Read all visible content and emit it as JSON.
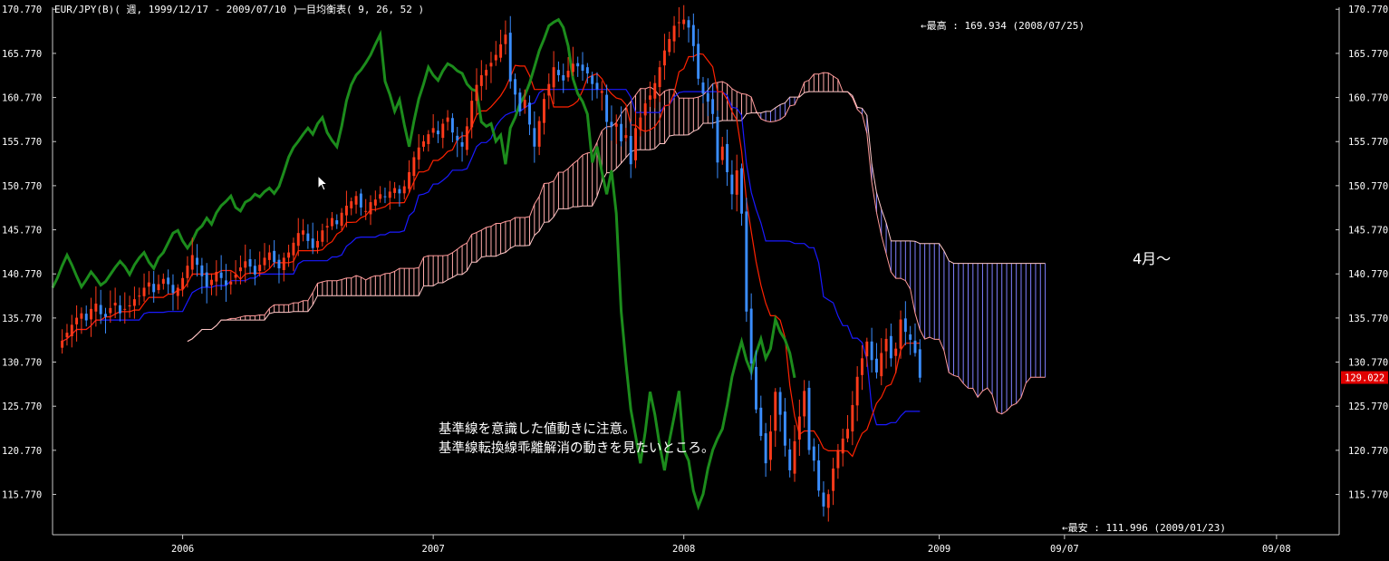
{
  "header": {
    "symbol_title": "EUR/JPY(B)( 週, 1999/12/17 - 2009/07/10 )",
    "indicator": "一目均衡表( 9, 26, 52 )"
  },
  "annotations": {
    "high": "←最高 : 169.934 (2008/07/25)",
    "low": "←最安 : 111.996 (2009/01/23)",
    "april": "4月～",
    "note_line1": "基準線を意識した値動きに注意。",
    "note_line2": "基準線転換線乖離解消の動きを見たいところ。",
    "last_price": "129.022"
  },
  "colors": {
    "background": "#000000",
    "axis": "#c8c8c8",
    "candle_up": "#ff3a1a",
    "candle_down": "#3a8dff",
    "tenkan": "#ff2200",
    "kijun": "#1a1aff",
    "chikou": "#1c8c1c",
    "cloud_up": "#ffaaaa",
    "cloud_down": "#8080ff",
    "price_badge": "#e00000"
  },
  "chart_data": {
    "type": "candlestick-ichimoku",
    "ylim": [
      111.2,
      171.0
    ],
    "y_ticks": [
      "170.770",
      "165.770",
      "160.770",
      "155.770",
      "150.770",
      "145.770",
      "140.770",
      "135.770",
      "130.770",
      "125.770",
      "120.770",
      "115.770"
    ],
    "x_ticks": [
      {
        "label": "2006",
        "week": 0
      },
      {
        "label": "2007",
        "week": 52
      },
      {
        "label": "2008",
        "week": 104
      },
      {
        "label": "2009",
        "week": 157
      },
      {
        "label": "09/07",
        "week": 183
      },
      {
        "label": "09/08",
        "week": 227
      }
    ],
    "x_first_visible_week": -27,
    "x_last_visible_week": 240,
    "weeks_plotted": "2005-07 .. 2009-07-10",
    "close": [
      133.2,
      134.1,
      135.0,
      135.8,
      136.3,
      135.5,
      136.8,
      137.4,
      136.2,
      135.9,
      136.9,
      137.5,
      136.3,
      136.8,
      137.2,
      137.9,
      138.3,
      139.2,
      139.8,
      138.7,
      139.6,
      140.2,
      139.6,
      138.6,
      139.2,
      140.3,
      141.7,
      142.9,
      141.8,
      140.5,
      139.3,
      140.1,
      141.0,
      140.3,
      139.5,
      139.9,
      140.7,
      141.5,
      142.2,
      141.6,
      140.7,
      141.8,
      142.6,
      143.2,
      142.1,
      141.4,
      142.6,
      143.2,
      144.3,
      145.4,
      145.7,
      144.5,
      143.7,
      144.5,
      145.7,
      146.2,
      147.1,
      146.4,
      147.7,
      148.5,
      149.0,
      149.6,
      148.3,
      147.9,
      148.9,
      149.2,
      149.8,
      149.5,
      150.1,
      150.5,
      149.9,
      150.7,
      152.3,
      154.0,
      155.1,
      155.8,
      156.6,
      157.3,
      156.6,
      157.8,
      158.5,
      156.8,
      155.9,
      155.2,
      157.5,
      160.4,
      162.2,
      163.3,
      163.9,
      164.7,
      165.6,
      166.8,
      167.9,
      162.6,
      161.1,
      159.2,
      160.5,
      157.7,
      155.2,
      158.1,
      160.6,
      162.3,
      164.2,
      163.3,
      162.7,
      163.8,
      164.6,
      164.3,
      163.8,
      163.5,
      162.3,
      161.7,
      161.5,
      158.0,
      157.5,
      157.8,
      155.8,
      156.5,
      153.2,
      157.3,
      158.5,
      160.1,
      161.0,
      162.4,
      164.2,
      166.1,
      167.4,
      168.9,
      169.3,
      169.6,
      168.7,
      166.6,
      162.9,
      161.2,
      160.3,
      158.9,
      153.4,
      155.2,
      152.3,
      149.8,
      152.5,
      147.6,
      136.5,
      130.6,
      125.4,
      122.4,
      119.3,
      122.9,
      127.4,
      124.8,
      121.3,
      118.5,
      121.8,
      124.6,
      127.5,
      120.8,
      119.6,
      116.2,
      114.4,
      115.8,
      118.7,
      120.8,
      122.1,
      123.2,
      125.9,
      129.1,
      131.2,
      133.1,
      131.0,
      129.6,
      131.8,
      133.4,
      131.2,
      132.3,
      135.6,
      134.2,
      133.3,
      131.8,
      129.0
    ]
  }
}
